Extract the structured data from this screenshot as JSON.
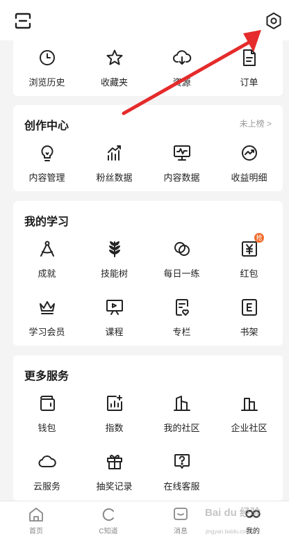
{
  "header": {
    "scan_icon": "scan-icon",
    "settings_icon": "hexagon-settings-icon"
  },
  "quick_links": {
    "items": [
      {
        "label": "浏览历史",
        "icon": "clock-icon"
      },
      {
        "label": "收藏夹",
        "icon": "star-icon"
      },
      {
        "label": "资源",
        "icon": "cloud-download-icon"
      },
      {
        "label": "订单",
        "icon": "document-icon"
      }
    ]
  },
  "creation": {
    "title": "创作中心",
    "extra": "未上榜 >",
    "items": [
      {
        "label": "内容管理",
        "icon": "lightbulb-icon"
      },
      {
        "label": "粉丝数据",
        "icon": "bar-chart-icon"
      },
      {
        "label": "内容数据",
        "icon": "monitor-pulse-icon"
      },
      {
        "label": "收益明细",
        "icon": "trend-circle-icon"
      }
    ]
  },
  "learning": {
    "title": "我的学习",
    "items": [
      {
        "label": "成就",
        "icon": "compass-icon"
      },
      {
        "label": "技能树",
        "icon": "wheat-icon"
      },
      {
        "label": "每日一练",
        "icon": "rings-icon"
      },
      {
        "label": "红包",
        "icon": "yuan-icon",
        "badge": "抢"
      },
      {
        "label": "学习会员",
        "icon": "crown-icon"
      },
      {
        "label": "课程",
        "icon": "presentation-icon"
      },
      {
        "label": "专栏",
        "icon": "column-heart-icon"
      },
      {
        "label": "书架",
        "icon": "book-e-icon"
      }
    ]
  },
  "services": {
    "title": "更多服务",
    "items": [
      {
        "label": "钱包",
        "icon": "wallet-icon"
      },
      {
        "label": "指数",
        "icon": "index-chart-icon"
      },
      {
        "label": "我的社区",
        "icon": "community-icon"
      },
      {
        "label": "企业社区",
        "icon": "enterprise-icon"
      },
      {
        "label": "云服务",
        "icon": "cloud-icon"
      },
      {
        "label": "抽奖记录",
        "icon": "gift-icon"
      },
      {
        "label": "在线客服",
        "icon": "help-chat-icon"
      }
    ]
  },
  "tabbar": {
    "tabs": [
      {
        "label": "首页",
        "icon": "home-icon"
      },
      {
        "label": "C知道",
        "icon": "c-know-icon"
      },
      {
        "label": "消息",
        "icon": "message-icon"
      },
      {
        "label": "我的",
        "icon": "profile-icon"
      }
    ]
  },
  "annotation": {
    "color": "#e52b2b"
  },
  "watermark": {
    "text": "Bai du 经验",
    "sub": "jingyan.baidu.com"
  }
}
